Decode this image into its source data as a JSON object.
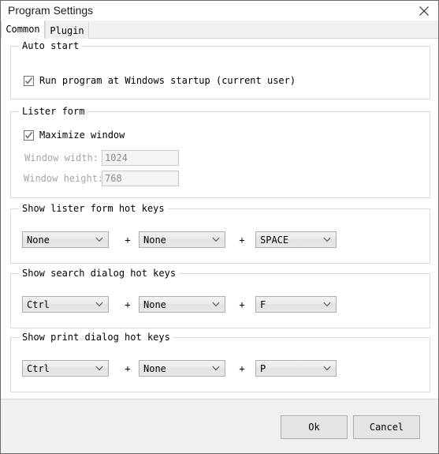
{
  "window": {
    "title": "Program Settings",
    "close_icon": "close-icon"
  },
  "tabs": [
    {
      "label": "Common",
      "active": true
    },
    {
      "label": "Plugin",
      "active": false
    }
  ],
  "groups": {
    "auto_start": {
      "label": "Auto start",
      "checkbox": {
        "label": "Run program at Windows startup (current user)",
        "checked": true
      }
    },
    "lister_form": {
      "label": "Lister form",
      "checkbox": {
        "label": "Maximize window",
        "checked": true
      },
      "fields": [
        {
          "label": "Window width:",
          "value": "1024",
          "enabled": false
        },
        {
          "label": "Window height:",
          "value": "768",
          "enabled": false
        }
      ]
    },
    "lister_hotkeys": {
      "label": "Show lister form hot keys",
      "separator": "+",
      "combos": [
        {
          "value": "None"
        },
        {
          "value": "None"
        },
        {
          "value": "SPACE"
        }
      ]
    },
    "search_hotkeys": {
      "label": "Show search dialog hot keys",
      "separator": "+",
      "combos": [
        {
          "value": "Ctrl"
        },
        {
          "value": "None"
        },
        {
          "value": "F"
        }
      ]
    },
    "print_hotkeys": {
      "label": "Show print dialog hot keys",
      "separator": "+",
      "combos": [
        {
          "value": "Ctrl"
        },
        {
          "value": "None"
        },
        {
          "value": "P"
        }
      ]
    }
  },
  "footer": {
    "ok_label": "Ok",
    "cancel_label": "Cancel"
  },
  "colors": {
    "window_border": "#6b6b6b",
    "group_border": "#dcdcdc",
    "footer_bg": "#f0f0f0",
    "tab_inactive_bg": "#f0f0f0",
    "disabled_text": "#a6a6a6"
  }
}
